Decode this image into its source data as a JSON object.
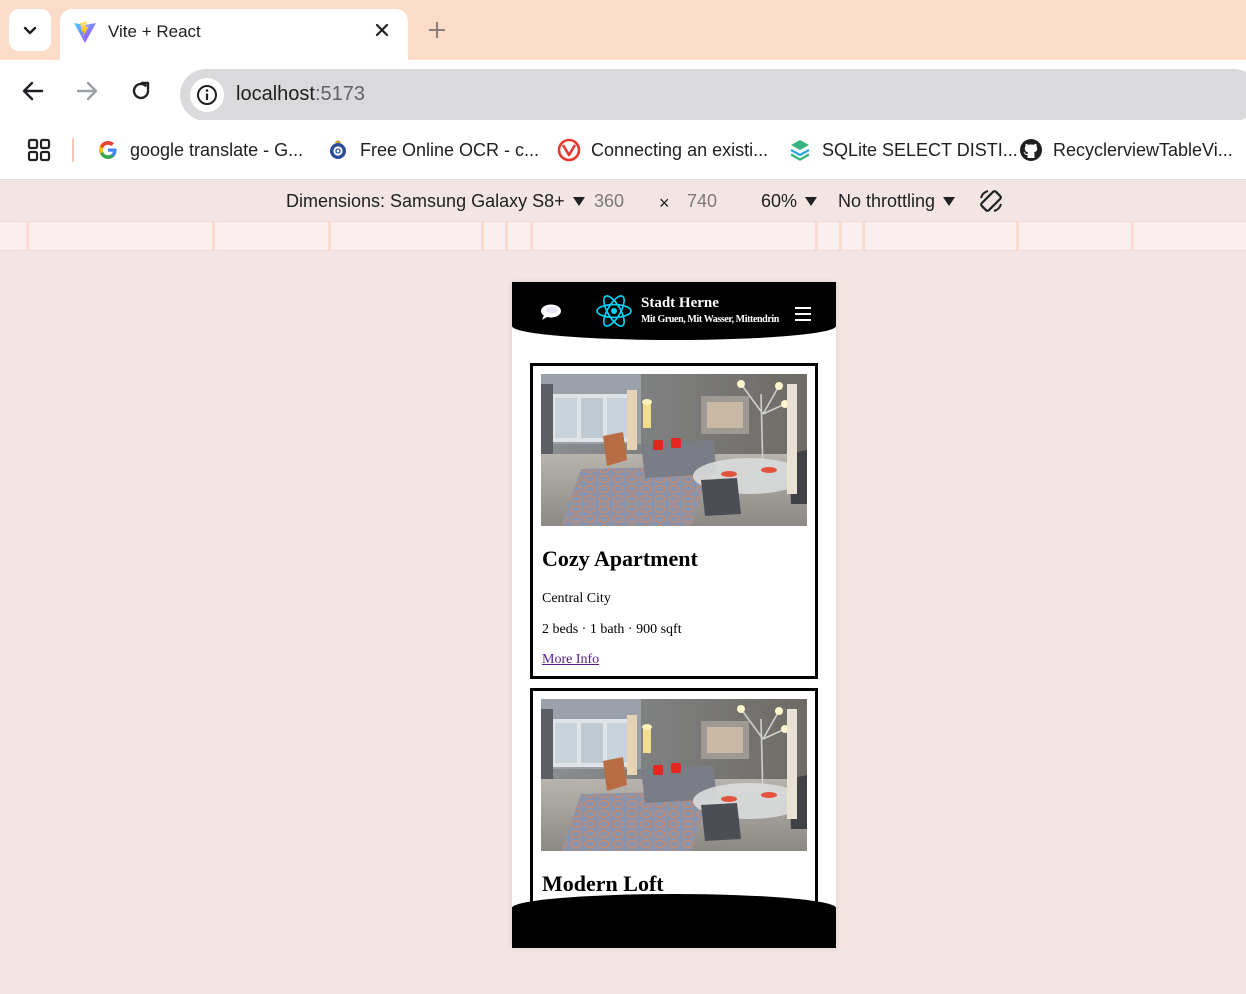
{
  "browser": {
    "tab": {
      "title": "Vite + React"
    },
    "address": {
      "host": "localhost",
      "port": ":5173"
    },
    "bookmarks": [
      {
        "label": "google translate - G...",
        "icon": "google-icon"
      },
      {
        "label": "Free Online OCR - c...",
        "icon": "ocr-icon"
      },
      {
        "label": "Connecting an existi...",
        "icon": "connect-icon"
      },
      {
        "label": "SQLite SELECT DISTI...",
        "icon": "sqlite-icon"
      },
      {
        "label": "RecyclerviewTableVi...",
        "icon": "github-icon"
      }
    ]
  },
  "devtools": {
    "dimensions_label": "Dimensions: Samsung Galaxy S8+",
    "width": "360",
    "times": "×",
    "height": "740",
    "zoom": "60%",
    "throttling": "No throttling"
  },
  "app": {
    "brand_title": "Stadt Herne",
    "brand_subtitle": "Mit Gruen, Mit Wasser, Mittendrin",
    "colors": {
      "header_bg": "#000000",
      "react_logo": "#00d8ff",
      "link": "#551a8b"
    },
    "listings": [
      {
        "title": "Cozy Apartment",
        "location": "Central City",
        "specs": "2 beds · 1 bath · 900 sqft",
        "link": "More Info"
      },
      {
        "title": "Modern Loft"
      }
    ]
  }
}
